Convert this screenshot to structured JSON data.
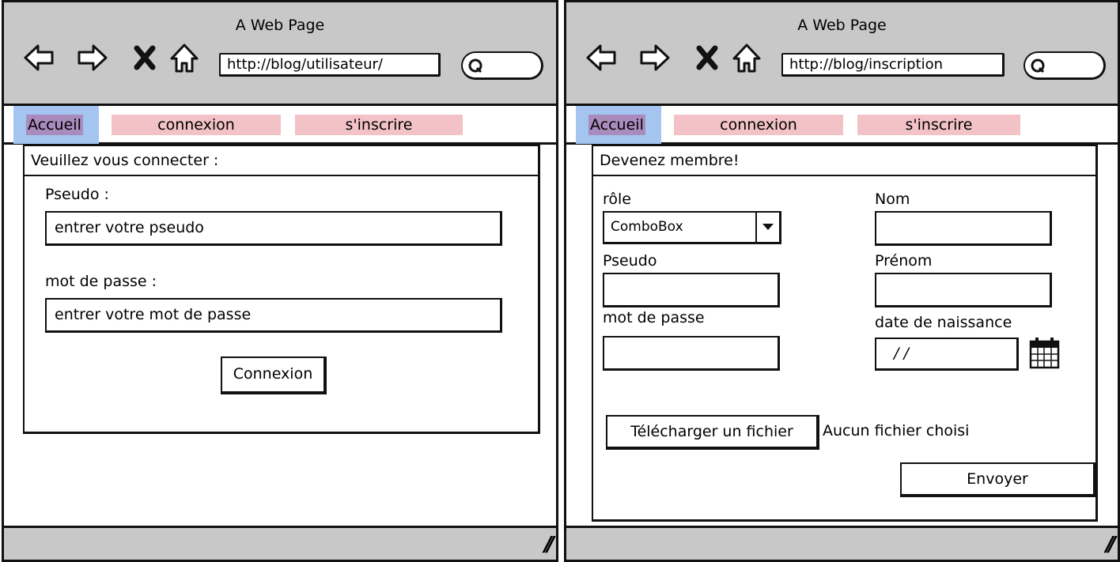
{
  "left": {
    "window_title": "A Web Page",
    "url": "http://blog/utilisateur/",
    "menu": {
      "home": "Accueil",
      "login": "connexion",
      "signup": "s'inscrire"
    },
    "panel_title": "Veuillez vous connecter :",
    "pseudo_label": "Pseudo :",
    "pseudo_placeholder": "entrer votre pseudo",
    "password_label": "mot de passe :",
    "password_placeholder": "entrer votre mot de passe",
    "submit_label": "Connexion"
  },
  "right": {
    "window_title": "A Web Page",
    "url": "http://blog/inscription",
    "menu": {
      "home": "Accueil",
      "login": "connexion",
      "signup": "s'inscrire"
    },
    "panel_title": "Devenez membre!",
    "role_label": "rôle",
    "role_value": "ComboBox",
    "pseudo_label": "Pseudo",
    "password_label": "mot de passe",
    "nom_label": "Nom",
    "prenom_label": "Prénom",
    "birthdate_label": "date de naissance",
    "birthdate_value": "/ /",
    "upload_label": "Télécharger un fichier",
    "no_file_text": "Aucun fichier choisi",
    "submit_label": "Envoyer"
  },
  "icons": [
    "back-arrow-icon",
    "forward-arrow-icon",
    "close-icon",
    "home-icon",
    "search-icon",
    "calendar-icon",
    "resize-grip-icon"
  ],
  "colors": {
    "chrome": "#c8c8c8",
    "home_highlight": "#a4c5ef",
    "home_label": "#a98bbd",
    "menu_item": "#f2c2c6"
  }
}
